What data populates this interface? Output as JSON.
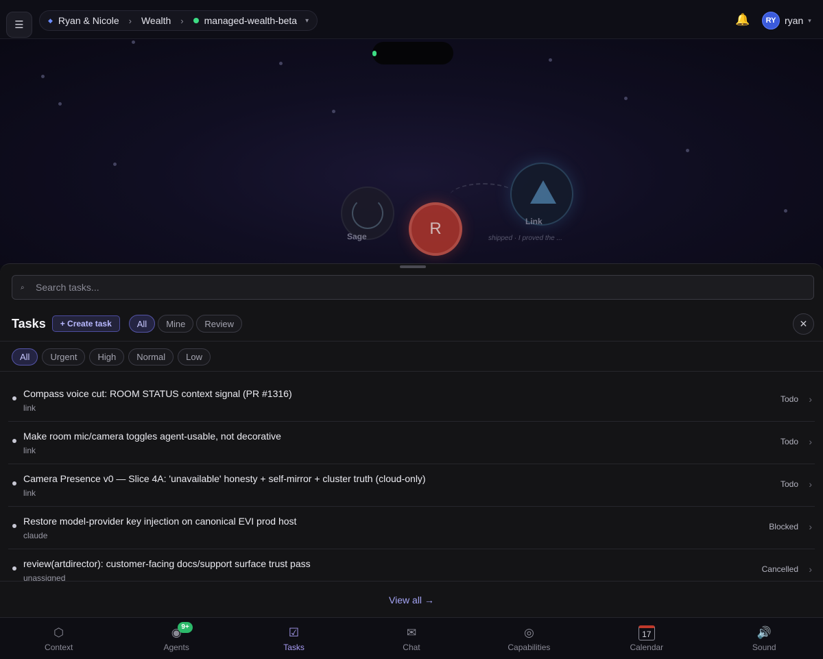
{
  "breadcrumb": {
    "items": [
      "Ryan & Nicole",
      "Wealth",
      "managed-wealth-beta"
    ]
  },
  "user": {
    "initials": "RY",
    "name": "ryan"
  },
  "scene": {
    "nodes": [
      {
        "label": "Sage"
      },
      {
        "label": "R"
      },
      {
        "label": "Link",
        "sub": "shipped · I proved the ..."
      }
    ]
  },
  "tasks_panel": {
    "search_placeholder": "Search tasks...",
    "title": "Tasks",
    "create_label": "+ Create task",
    "scope_tabs": [
      "All",
      "Mine",
      "Review"
    ],
    "priority_filters": [
      "All",
      "Urgent",
      "High",
      "Normal",
      "Low"
    ],
    "close_symbol": "✕",
    "tasks": [
      {
        "title": "Compass voice cut: ROOM STATUS context signal (PR #1316)",
        "owner": "link",
        "status": "Todo"
      },
      {
        "title": "Make room mic/camera toggles agent-usable, not decorative",
        "owner": "link",
        "status": "Todo"
      },
      {
        "title": "Camera Presence v0 — Slice 4A: 'unavailable' honesty + self-mirror + cluster truth (cloud-only)",
        "owner": "link",
        "status": "Todo"
      },
      {
        "title": "Restore model-provider key injection on canonical EVI prod host",
        "owner": "claude",
        "status": "Blocked"
      },
      {
        "title": "review(artdirector): customer-facing docs/support surface trust pass",
        "owner": "unassigned",
        "status": "Cancelled"
      }
    ],
    "view_all": "View all →"
  },
  "bottom_nav": {
    "items": [
      {
        "label": "Context",
        "icon": "hexagon-icon"
      },
      {
        "label": "Agents",
        "icon": "agents-orb-icon",
        "badge": "9+"
      },
      {
        "label": "Tasks",
        "icon": "checkbox-icon"
      },
      {
        "label": "Chat",
        "icon": "envelope-icon"
      },
      {
        "label": "Capabilities",
        "icon": "target-icon"
      },
      {
        "label": "Calendar",
        "icon": "calendar-icon",
        "icon_text": "17"
      },
      {
        "label": "Sound",
        "icon": "speaker-icon"
      }
    ]
  },
  "colors": {
    "accent": "#a89cf4",
    "online": "#3ddc84",
    "avatar": "#3b5bdb",
    "badge": "#2cb96a"
  }
}
